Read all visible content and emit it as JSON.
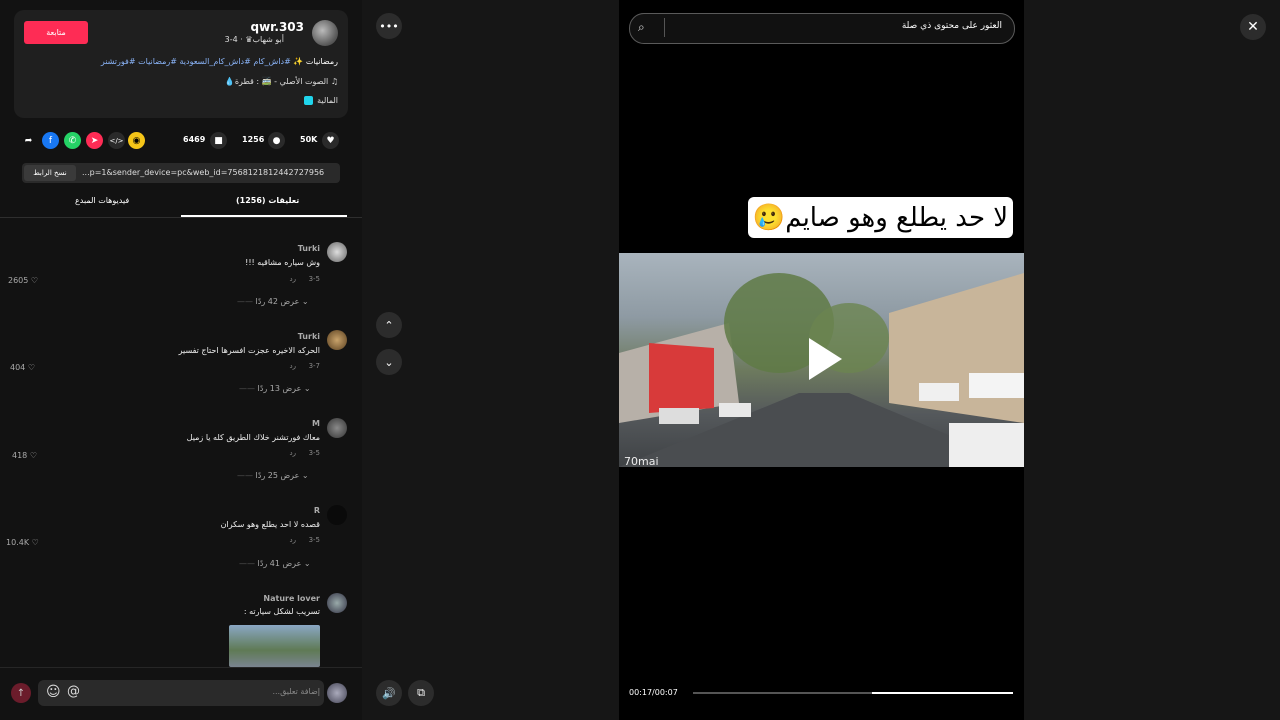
{
  "profile": {
    "username": "qwr.303",
    "subtitle": "أبو شهاب♛ · 4-3",
    "follow_label": "متابعة"
  },
  "caption": {
    "prefix": "رمضانيات ✨",
    "tags": [
      "#داش_كام",
      "#داش_كام_السعودية",
      "#رمضانيات",
      "#فورتشنر"
    ]
  },
  "music": "♫ الصوت الأصلي - 🚎 : قطرة💧",
  "badge": "المالية",
  "actions": {
    "likes": "50K",
    "comments": "1256",
    "saves": "6469"
  },
  "link": {
    "copy_label": "نسخ الرابط",
    "url": "...p=1&sender_device=pc&web_id=7568121812442727956"
  },
  "tabs": {
    "comments": "(1256) تعليقات",
    "creator_videos": "فيديوهات المبدع"
  },
  "comments": [
    {
      "name": "Turki",
      "text": "وش سياره مشاقيه !!!",
      "date": "3-5",
      "reply": "رد",
      "likes": "2605",
      "replies": "عرض 42 ردًا"
    },
    {
      "name": "Turki",
      "text": "الحركه الاخيره عجزت افسرها احتاج تفسير",
      "date": "3-7",
      "reply": "رد",
      "likes": "404",
      "replies": "عرض 13 ردًا"
    },
    {
      "name": "M",
      "text": "معاك فورتشنر خلاك الطريق كله يا زميل",
      "date": "3-5",
      "reply": "رد",
      "likes": "418",
      "replies": "عرض 25 ردًا"
    },
    {
      "name": "R",
      "text": "قصده لا احد يطلع وهو سكران",
      "date": "3-5",
      "reply": "رد",
      "likes": "10.4K",
      "replies": "عرض 41 ردًا"
    },
    {
      "name": "Nature lover",
      "text": "تسريب لشكل سيارته :"
    }
  ],
  "comment_input": {
    "placeholder": "إضافة تعليق...",
    "at_symbol": "@"
  },
  "search": {
    "placeholder": "العثور على محتوى ذي صلة"
  },
  "video": {
    "overlay_text": "لا حد يطلع وهو صايم🥲",
    "watermark": "70mai",
    "time": "00:17/00:07",
    "progress": 0.56
  },
  "icons": {
    "more": "•••",
    "up": "⌃",
    "down": "⌄",
    "close": "✕"
  }
}
